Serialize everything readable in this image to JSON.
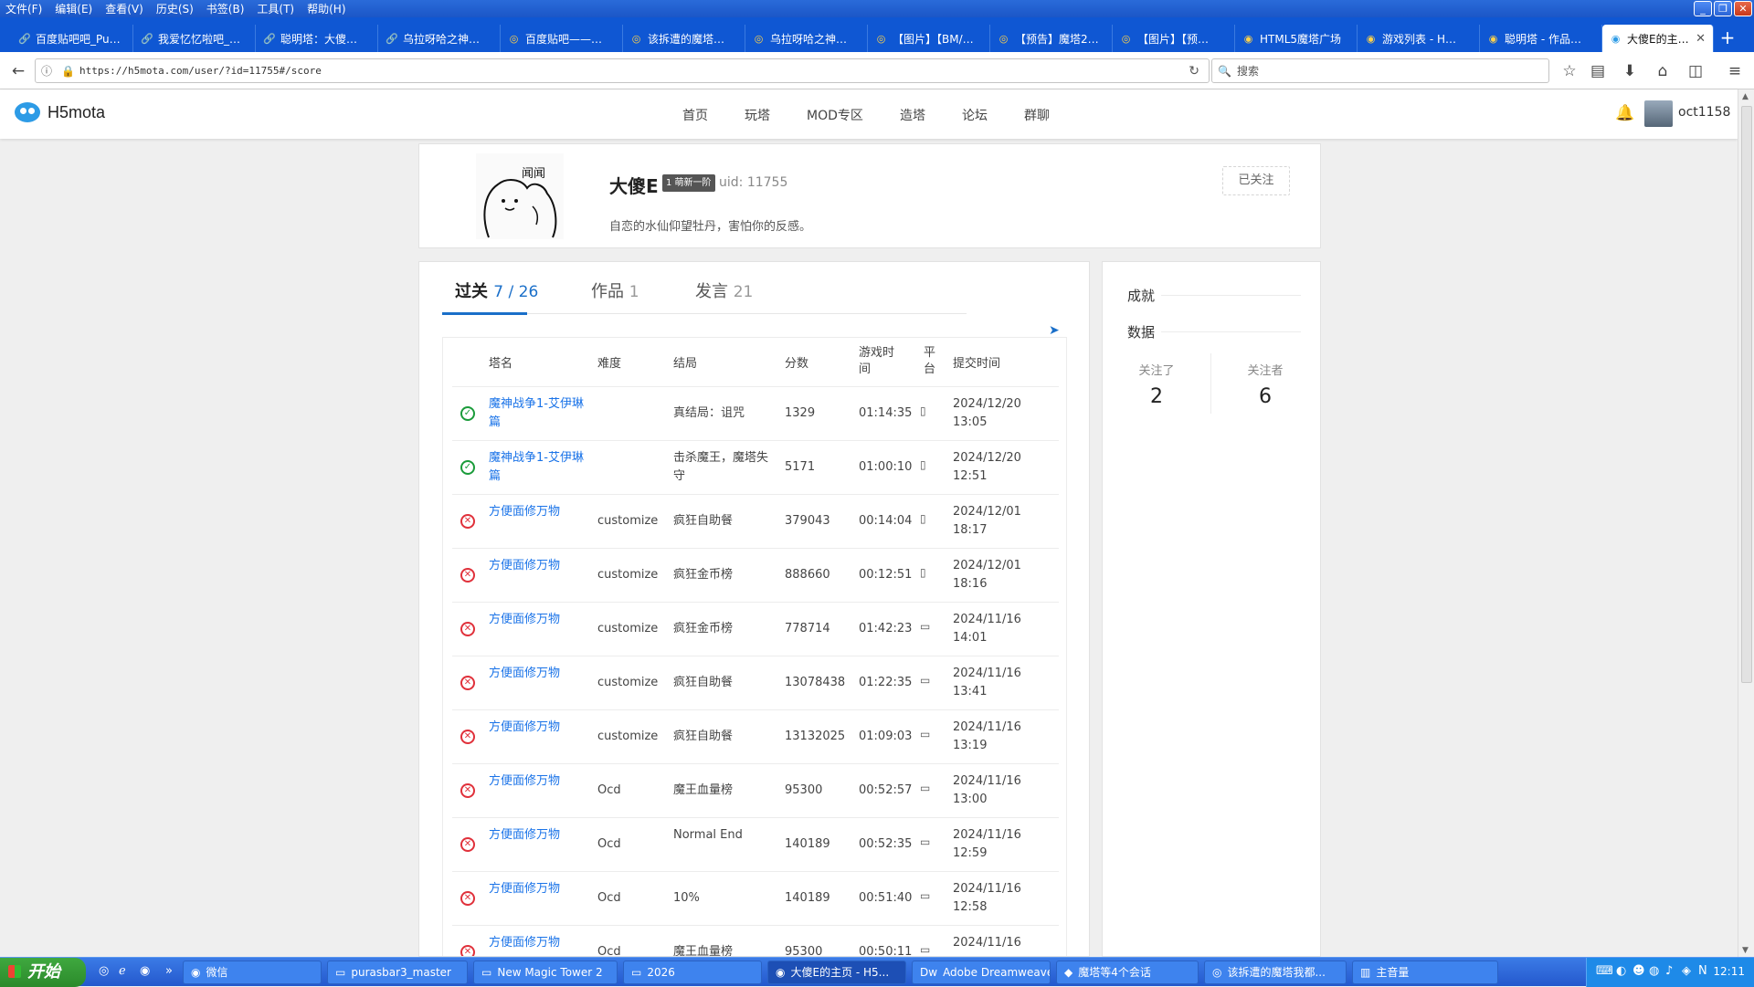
{
  "menubar": [
    "文件(F)",
    "编辑(E)",
    "查看(V)",
    "历史(S)",
    "书签(B)",
    "工具(T)",
    "帮助(H)"
  ],
  "tabs": [
    {
      "label": "百度贴吧吧_Pu…",
      "icon": "🔗"
    },
    {
      "label": "我爱忆忆啦吧_…",
      "icon": "🔗"
    },
    {
      "label": "聪明塔：大傻…",
      "icon": "🔗"
    },
    {
      "label": "乌拉呀哈之神…",
      "icon": "🔗"
    },
    {
      "label": "百度贴吧——…",
      "icon": "◎"
    },
    {
      "label": "该拆遭的魔塔…",
      "icon": "◎"
    },
    {
      "label": "乌拉呀哈之神…",
      "icon": "◎"
    },
    {
      "label": "【图片】【BM/…",
      "icon": "◎"
    },
    {
      "label": "【预告】魔塔2…",
      "icon": "◎"
    },
    {
      "label": "【图片】【预…",
      "icon": "◎"
    },
    {
      "label": "HTML5魔塔广场",
      "icon": "◉"
    },
    {
      "label": "游戏列表 - H…",
      "icon": "◉"
    },
    {
      "label": "聪明塔 - 作品…",
      "icon": "◉"
    },
    {
      "label": "大傻E的主…",
      "icon": "◉",
      "active": true
    }
  ],
  "url": "https://h5mota.com/user/?id=11755#/score",
  "search_placeholder": "搜索",
  "site": {
    "logo": "H5mota",
    "nav": [
      "首页",
      "玩塔",
      "MOD专区",
      "造塔",
      "论坛",
      "群聊"
    ],
    "user": "oct1158"
  },
  "profile": {
    "name": "大傻E",
    "level": "1 萌新一阶",
    "uid": "uid: 11755",
    "bio": "自恋的水仙仰望牡丹，害怕你的反感。",
    "follow_btn": "已关注"
  },
  "main_tabs": [
    {
      "label": "过关",
      "count": "7 / 26"
    },
    {
      "label": "作品",
      "count": "1"
    },
    {
      "label": "发言",
      "count": "21"
    }
  ],
  "table": {
    "headers": [
      "塔名",
      "难度",
      "结局",
      "分数",
      "游戏时间",
      "平台",
      "提交时间"
    ],
    "rows": [
      {
        "status": "ok",
        "name": "魔神战争1-艾伊琳篇",
        "difficulty": "",
        "ending": "真结局：诅咒",
        "score": "1329",
        "time": "01:14:35",
        "platform": "mobile",
        "submitted": "2024/12/20 13:05"
      },
      {
        "status": "ok",
        "name": "魔神战争1-艾伊琳篇",
        "difficulty": "",
        "ending": "击杀魔王，魔塔失守",
        "score": "5171",
        "time": "01:00:10",
        "platform": "mobile",
        "submitted": "2024/12/20 12:51"
      },
      {
        "status": "fail",
        "name": "方便面修万物",
        "difficulty": "customize",
        "ending": "疯狂自助餐",
        "score": "379043",
        "time": "00:14:04",
        "platform": "mobile",
        "submitted": "2024/12/01 18:17"
      },
      {
        "status": "fail",
        "name": "方便面修万物",
        "difficulty": "customize",
        "ending": "疯狂金币榜",
        "score": "888660",
        "time": "00:12:51",
        "platform": "mobile",
        "submitted": "2024/12/01 18:16"
      },
      {
        "status": "fail",
        "name": "方便面修万物",
        "difficulty": "customize",
        "ending": "疯狂金币榜",
        "score": "778714",
        "time": "01:42:23",
        "platform": "desktop",
        "submitted": "2024/11/16 14:01"
      },
      {
        "status": "fail",
        "name": "方便面修万物",
        "difficulty": "customize",
        "ending": "疯狂自助餐",
        "score": "13078438",
        "time": "01:22:35",
        "platform": "desktop",
        "submitted": "2024/11/16 13:41"
      },
      {
        "status": "fail",
        "name": "方便面修万物",
        "difficulty": "customize",
        "ending": "疯狂自助餐",
        "score": "13132025",
        "time": "01:09:03",
        "platform": "desktop",
        "submitted": "2024/11/16 13:19"
      },
      {
        "status": "fail",
        "name": "方便面修万物",
        "difficulty": "Ocd",
        "ending": "魔王血量榜",
        "score": "95300",
        "time": "00:52:57",
        "platform": "desktop",
        "submitted": "2024/11/16 13:00"
      },
      {
        "status": "fail",
        "name": "方便面修万物",
        "difficulty": "Ocd",
        "ending": "Normal End",
        "score": "140189",
        "time": "00:52:35",
        "platform": "desktop",
        "submitted": "2024/11/16 12:59"
      },
      {
        "status": "fail",
        "name": "方便面修万物",
        "difficulty": "Ocd",
        "ending": "10%",
        "score": "140189",
        "time": "00:51:40",
        "platform": "desktop",
        "submitted": "2024/11/16 12:58"
      },
      {
        "status": "fail",
        "name": "方便面修万物",
        "difficulty": "Ocd",
        "ending": "魔王血量榜",
        "score": "95300",
        "time": "00:50:11",
        "platform": "desktop",
        "submitted": "2024/11/16"
      }
    ]
  },
  "side": {
    "achievements": "成就",
    "data": "数据",
    "following_label": "关注了",
    "following": "2",
    "followers_label": "关注者",
    "followers": "6"
  },
  "taskbar": {
    "start": "开始",
    "tasks": [
      {
        "label": "微信",
        "icon": "◉"
      },
      {
        "label": "purasbar3_master",
        "icon": "▭"
      },
      {
        "label": "New Magic Tower 2",
        "icon": "▭"
      },
      {
        "label": "2026",
        "icon": "▭"
      },
      {
        "label": "大傻E的主页 - H5...",
        "icon": "◉",
        "active": true
      },
      {
        "label": "Adobe Dreamweave...",
        "icon": "Dw"
      },
      {
        "label": "魔塔等4个会话",
        "icon": "◆"
      },
      {
        "label": "该拆遭的魔塔我都...",
        "icon": "◎"
      },
      {
        "label": "主音量",
        "icon": "▥"
      }
    ],
    "clock": "12:11"
  }
}
